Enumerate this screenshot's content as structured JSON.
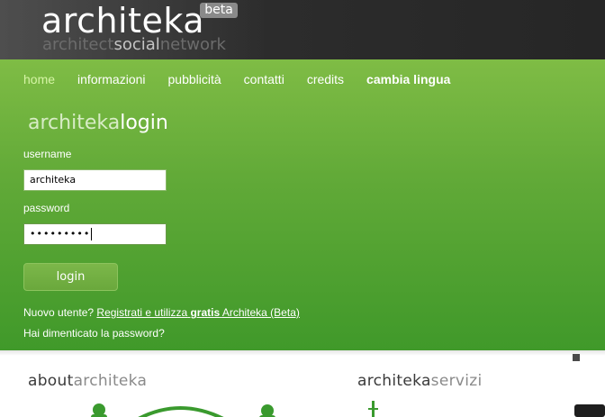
{
  "header": {
    "logo_text": "architeka",
    "beta_badge": "beta",
    "tagline_part1": "architect",
    "tagline_part2": "social",
    "tagline_part3": "network"
  },
  "nav": {
    "items": [
      {
        "label": "home",
        "active": true
      },
      {
        "label": "informazioni"
      },
      {
        "label": "pubblicità"
      },
      {
        "label": "contatti"
      },
      {
        "label": "credits"
      },
      {
        "label": "cambia lingua",
        "bold": true
      }
    ]
  },
  "login": {
    "title_part1": "architeka",
    "title_part2": "login",
    "username_label": "username",
    "username_value": "architeka",
    "password_label": "password",
    "password_value": "•••••••••",
    "button_label": "login",
    "newuser_prefix": "Nuovo utente?",
    "register_link_part1": "Registrati e utilizza",
    "register_link_bold": "gratis",
    "register_link_part2": "Architeka (Beta)",
    "forgot_password": "Hai dimenticato la password?"
  },
  "sections": {
    "about_part1": "about",
    "about_part2": "architeka",
    "services_part1": "architeka",
    "services_part2": "servizi"
  },
  "colors": {
    "header_dark": "#2c2c2c",
    "green_top": "#7fbc45",
    "green_bottom": "#40992a",
    "nav_active": "#d6f5a6",
    "illustration_green": "#3a9a2e"
  }
}
